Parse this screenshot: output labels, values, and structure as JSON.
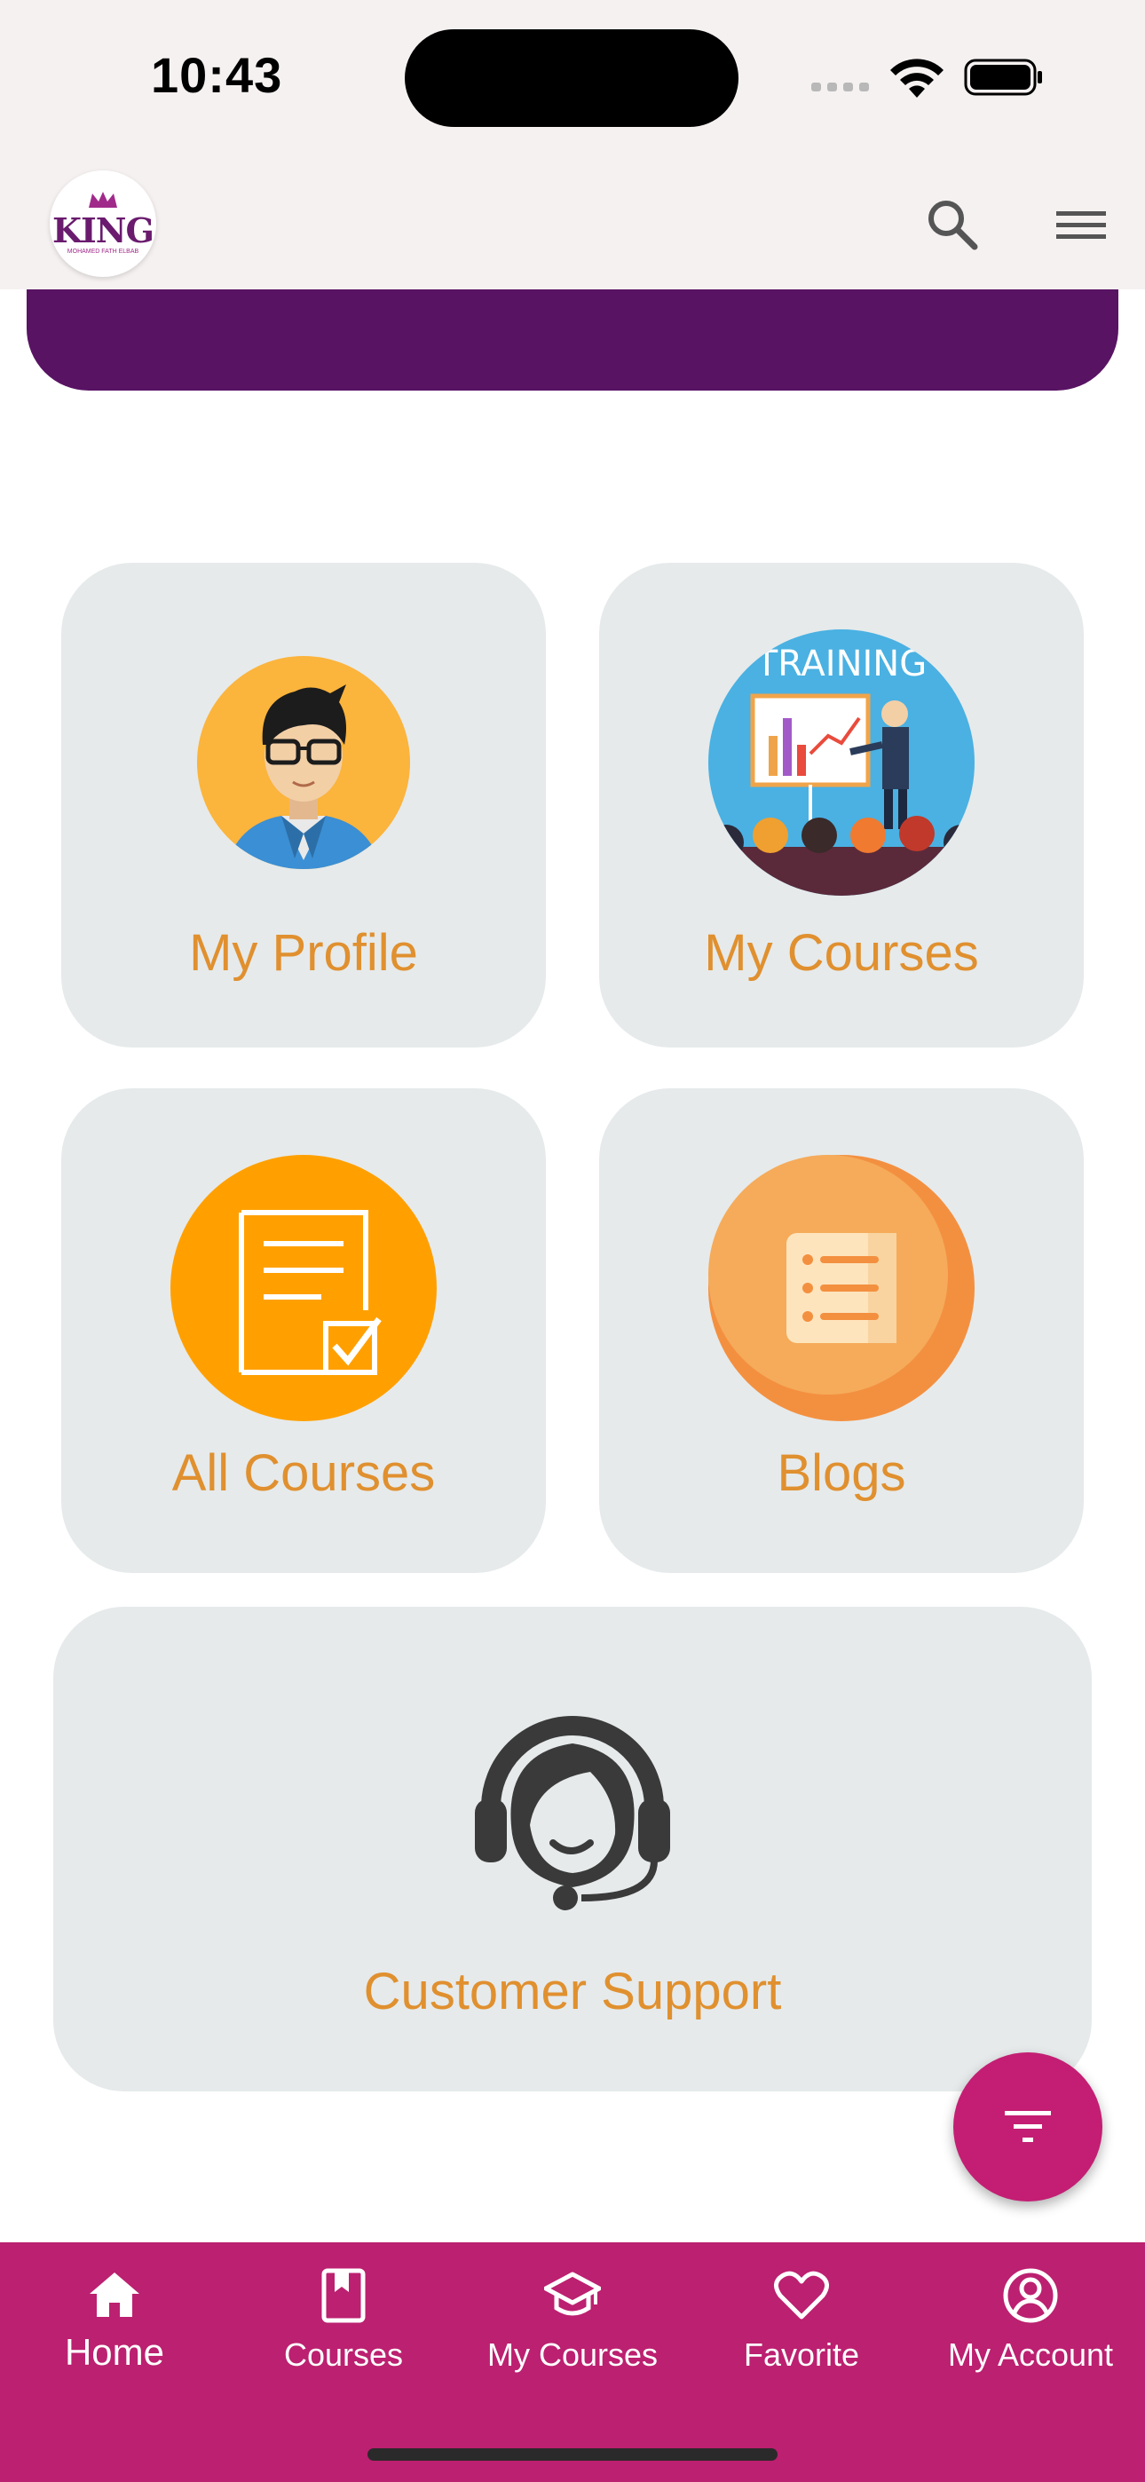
{
  "status": {
    "time": "10:43"
  },
  "app_bar": {
    "logo_text": "KING",
    "logo_subtitle": "MOHAMED FATH ELBAB"
  },
  "cards": {
    "profile": {
      "label": "My Profile",
      "icon": "user-avatar-icon"
    },
    "my_courses": {
      "label": "My Courses",
      "icon": "training-presentation-icon",
      "image_text": "TRAINING"
    },
    "all_courses": {
      "label": "All Courses",
      "icon": "document-check-icon"
    },
    "blogs": {
      "label": "Blogs",
      "icon": "list-document-icon"
    },
    "support": {
      "label": "Customer Support",
      "icon": "headset-agent-icon"
    }
  },
  "fab": {
    "icon": "filter-icon"
  },
  "bottom_nav": {
    "items": [
      {
        "label": "Home",
        "icon": "home-icon",
        "active": true
      },
      {
        "label": "Courses",
        "icon": "book-icon"
      },
      {
        "label": "My Courses",
        "icon": "graduation-cap-icon"
      },
      {
        "label": "Favorite",
        "icon": "heart-icon"
      },
      {
        "label": "My Account",
        "icon": "account-circle-icon"
      }
    ]
  },
  "colors": {
    "brand_purple": "#581363",
    "accent_magenta": "#bc2070",
    "label_orange": "#e0902f",
    "card_bg": "#e6eaeb",
    "app_bar_bg": "#f6f1f1"
  }
}
